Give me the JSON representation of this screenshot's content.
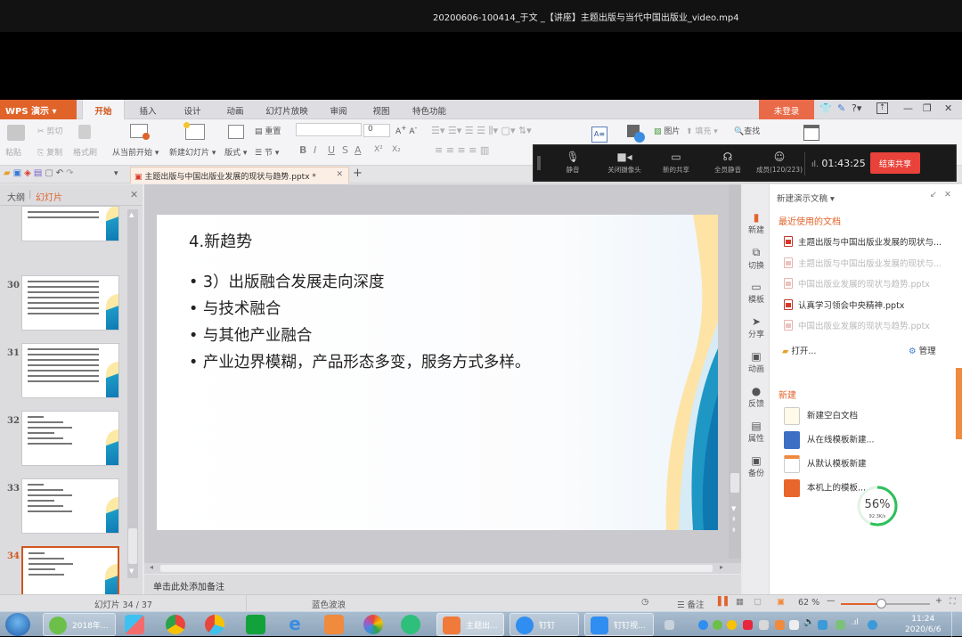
{
  "video_title": "20200606-100414_于文 _【讲座】主题出版与当代中国出版业_video.mp4",
  "app": {
    "name": "WPS 演示",
    "tabs": [
      "开始",
      "插入",
      "设计",
      "动画",
      "幻灯片放映",
      "审阅",
      "视图",
      "特色功能"
    ],
    "active_tab": "开始",
    "login_label": "未登录",
    "help_label": "?",
    "ribbon": {
      "paste": "粘贴",
      "cut": "剪切",
      "copy": "复制",
      "format_painter": "格式刷",
      "from_current": "从当前开始",
      "new_slide": "新建幻灯片",
      "layout": "版式",
      "reset": "重置",
      "section": "节",
      "font_name": "",
      "font_size": "0",
      "bold": "B",
      "italic": "I",
      "underline": "U",
      "strike": "S",
      "font_color": "A",
      "superscript": "X²",
      "subscript": "X₂",
      "picture": "图片",
      "fill": "填充",
      "find": "查找"
    },
    "document_tab": "主题出版与中国出版业发展的现状与趋势.pptx *",
    "add_tab": "+"
  },
  "share_bar": {
    "items": [
      {
        "icon": "microphone-icon",
        "label": "静音"
      },
      {
        "icon": "camera-icon",
        "label": "关闭摄像头"
      },
      {
        "icon": "screen-share-icon",
        "label": "新的共享"
      },
      {
        "icon": "mute-all-icon",
        "label": "全员静音"
      },
      {
        "icon": "members-icon",
        "label": "成员(120/223)"
      }
    ],
    "timer": "01:43:25",
    "end_label": "结束共享"
  },
  "left_pane": {
    "tab_outline": "大纲",
    "tab_slides": "幻灯片",
    "slides": [
      {
        "num": "",
        "lines": 2
      },
      {
        "num": "30",
        "lines": 7
      },
      {
        "num": "31",
        "lines": 7
      },
      {
        "num": "32",
        "lines": 6
      },
      {
        "num": "33",
        "lines": 6
      },
      {
        "num": "34",
        "lines": 5,
        "selected": true
      }
    ]
  },
  "slide": {
    "title": "4.新趋势",
    "bullets": [
      "3）出版融合发展走向深度",
      "与技术融合",
      "与其他产业融合",
      "产业边界模糊，产品形态多变，服务方式多样。"
    ]
  },
  "notes_placeholder": "单击此处添加备注",
  "right_pane": {
    "side_icons": [
      "新建",
      "切换",
      "模板",
      "分享",
      "动画",
      "反馈",
      "属性",
      "备份"
    ],
    "header": "新建演示文稿",
    "recent_title": "最近使用的文档",
    "recent_docs": [
      {
        "name": "主题出版与中国出版业发展的现状与...",
        "dim": false
      },
      {
        "name": "主题出版与中国出版业发展的现状与...",
        "dim": true
      },
      {
        "name": "中国出版业发展的现状与趋势.pptx",
        "dim": true
      },
      {
        "name": "认真学习领会中央精神.pptx",
        "dim": false
      },
      {
        "name": "中国出版业发展的现状与趋势.pptx",
        "dim": true
      }
    ],
    "open_label": "打开...",
    "manage_label": "管理",
    "new_title": "新建",
    "new_items": [
      "新建空白文档",
      "从在线模板新建...",
      "从默认模板新建",
      "本机上的模板..."
    ],
    "progress_percent": 56,
    "progress_label": "56%",
    "speed": "92.3K/s"
  },
  "status_bar": {
    "slide_counter": "幻灯片 34 / 37",
    "theme": "蓝色波浪",
    "notes_label": "备注",
    "zoom": "62 %",
    "zoom_fraction": 0.45
  },
  "taskbar": {
    "items": [
      {
        "label": "2018年...",
        "color": "#6cc04a"
      },
      {
        "label": "主题出...",
        "color": "#f07a3a"
      },
      {
        "label": "钉钉",
        "color": "#2f8ef0"
      },
      {
        "label": "钉钉视...",
        "color": "#2f8ef0"
      }
    ],
    "time": "11:24",
    "date": "2020/6/6"
  }
}
